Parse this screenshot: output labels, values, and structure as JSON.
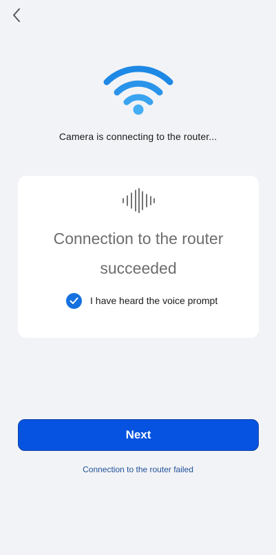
{
  "header": {
    "back_icon": "chevron-left-icon"
  },
  "status": {
    "icon": "wifi-icon",
    "text": "Camera is connecting to the router..."
  },
  "card": {
    "icon": "sound-wave-icon",
    "result_line1": "Connection to the router",
    "result_line2": "succeeded",
    "confirm_checked": true,
    "confirm_label": "I have heard the voice prompt"
  },
  "actions": {
    "next_label": "Next",
    "failed_link": "Connection to the router failed"
  },
  "colors": {
    "background": "#f2f3f6",
    "accent": "#0553e0",
    "wifi_blue": "#1e88e5",
    "link": "#1f4f98"
  }
}
